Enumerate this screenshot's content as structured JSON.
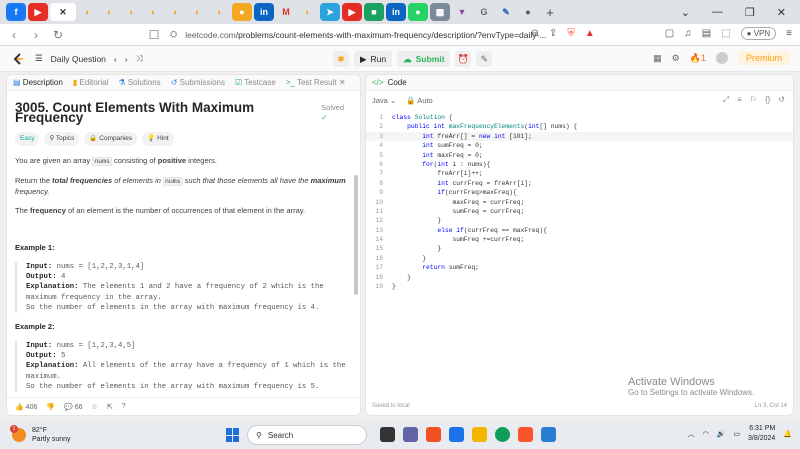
{
  "browser": {
    "url_host": "leetcode.com",
    "url_path": "/problems/count-elements-with-maximum-frequency/description/?envType=daily-...",
    "vpn_label": "VPN"
  },
  "header": {
    "daily_label": "Daily Question",
    "run_label": "Run",
    "submit_label": "Submit",
    "streak": "1",
    "premium_label": "Premium"
  },
  "left_tabs": [
    "Description",
    "Editorial",
    "Solutions",
    "Submissions",
    "Testcase",
    "Test Result"
  ],
  "problem": {
    "title": "3005. Count Elements With Maximum Frequency",
    "status": "Solved",
    "difficulty": "Easy",
    "topics_label": "Topics",
    "companies_label": "Companies",
    "hint_label": "Hint",
    "p1_pre": "You are given an array ",
    "p1_code": "nums",
    "p1_mid": " consisting of ",
    "p1_bold": "positive",
    "p1_post": " integers.",
    "p2_pre": "Return the ",
    "p2_bold": "total frequencies",
    "p2_mid": " of elements in ",
    "p2_code": "nums",
    "p2_mid2": " such that those elements all have the ",
    "p2_bold2": "maximum",
    "p2_post": " frequency.",
    "p3_pre": "The ",
    "p3_bold": "frequency",
    "p3_post": " of an element is the number of occurrences of that element in the array.",
    "ex1_title": "Example 1:",
    "ex1_input_label": "Input:",
    "ex1_input": " nums = [1,2,2,3,1,4]",
    "ex1_output_label": "Output:",
    "ex1_output": " 4",
    "ex1_expl_label": "Explanation:",
    "ex1_expl": " The elements 1 and 2 have a frequency of 2 which is the maximum frequency in the array.\nSo the number of elements in the array with maximum frequency is 4.",
    "ex2_title": "Example 2:",
    "ex2_input_label": "Input:",
    "ex2_input": " nums = [1,2,3,4,5]",
    "ex2_output_label": "Output:",
    "ex2_output": " 5",
    "ex2_expl_label": "Explanation:",
    "ex2_expl": " All elements of the array have a frequency of 1 which is the maximum.\nSo the number of elements in the array with maximum frequency is 5."
  },
  "footer_left": {
    "likes": "406",
    "comments": "66"
  },
  "editor": {
    "title": "Code",
    "language": "Java",
    "mode": "Auto",
    "saved": "Saved to local",
    "cursor": "Ln 3, Col 14",
    "lines": [
      "class Solution {",
      "    public int maxFrequencyElements(int[] nums) {",
      "        int freArr[] = new int [101];",
      "        int sumFreq = 0;",
      "        int maxFreq = 0;",
      "        for(int i : nums){",
      "            freArr[i]++;",
      "            int currFreq = freArr[i];",
      "            if(currFreq>maxFreq){",
      "                maxFreq = currFreq;",
      "                sumFreq = currFreq;",
      "            }",
      "            else if(currFreq == maxFreq){",
      "                sumFreq +=currFreq;",
      "            }",
      "        }",
      "        return sumFreq;",
      "    }",
      "}"
    ]
  },
  "watermark": {
    "line1": "Activate Windows",
    "line2": "Go to Settings to activate Windows."
  },
  "taskbar": {
    "temp": "82°F",
    "weather": "Partly sunny",
    "search": "Search",
    "time": "6:31 PM",
    "date": "3/8/2024"
  }
}
